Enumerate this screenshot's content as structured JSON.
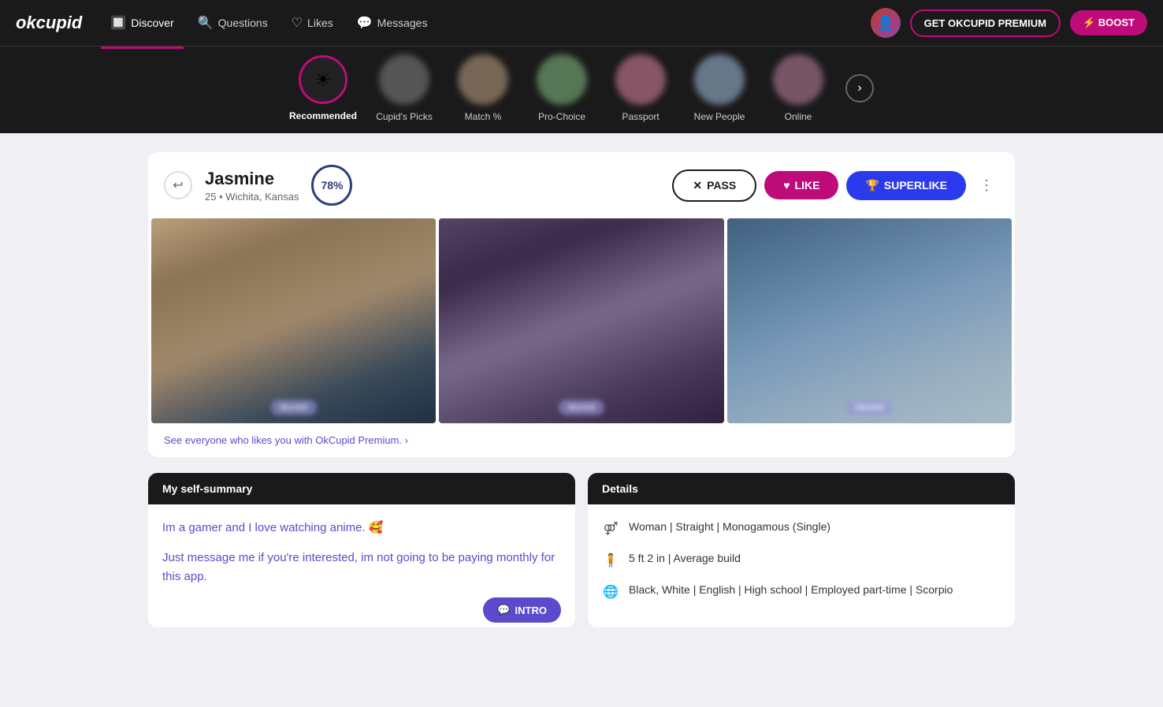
{
  "logo": "okcupid",
  "nav": {
    "items": [
      {
        "id": "discover",
        "label": "Discover",
        "icon": "🔍",
        "active": true
      },
      {
        "id": "questions",
        "label": "Questions",
        "icon": "❓"
      },
      {
        "id": "likes",
        "label": "Likes",
        "icon": "♡"
      },
      {
        "id": "messages",
        "label": "Messages",
        "icon": "💬"
      }
    ]
  },
  "header_actions": {
    "premium_label": "GET OKCUPID PREMIUM",
    "boost_label": "⚡ BOOST"
  },
  "categories": [
    {
      "id": "recommended",
      "label": "Recommended",
      "active": true,
      "icon": "✨"
    },
    {
      "id": "cupids-picks",
      "label": "Cupid's Picks",
      "active": false
    },
    {
      "id": "match",
      "label": "Match %",
      "active": false
    },
    {
      "id": "pro-choice",
      "label": "Pro-Choice",
      "active": false
    },
    {
      "id": "passport",
      "label": "Passport",
      "active": false
    },
    {
      "id": "new-people",
      "label": "New People",
      "active": false
    },
    {
      "id": "online",
      "label": "Online",
      "active": false
    }
  ],
  "profile": {
    "name": "Jasmine",
    "age": "25",
    "location": "Wichita, Kansas",
    "match_percent": "78%",
    "pass_label": "PASS",
    "like_label": "LIKE",
    "superlike_label": "SUPERLIKE",
    "photo_labels": [
      "blurred",
      "blurred",
      "blurred"
    ],
    "premium_prompt": "See everyone who likes you with OkCupid Premium. ›",
    "self_summary_header": "My self-summary",
    "self_summary_line1": "Im a gamer and I love watching anime. 🥰",
    "self_summary_line2": "Just message me if you're interested, im not going to be paying monthly for this app.",
    "intro_label": "INTRO",
    "details_header": "Details",
    "details": [
      {
        "icon": "👤",
        "text": "Woman | Straight | Monogamous (Single)"
      },
      {
        "icon": "📏",
        "text": "5 ft 2 in | Average build"
      },
      {
        "icon": "🌍",
        "text": "Black, White | English | High school | Employed part-time | Scorpio"
      }
    ]
  }
}
